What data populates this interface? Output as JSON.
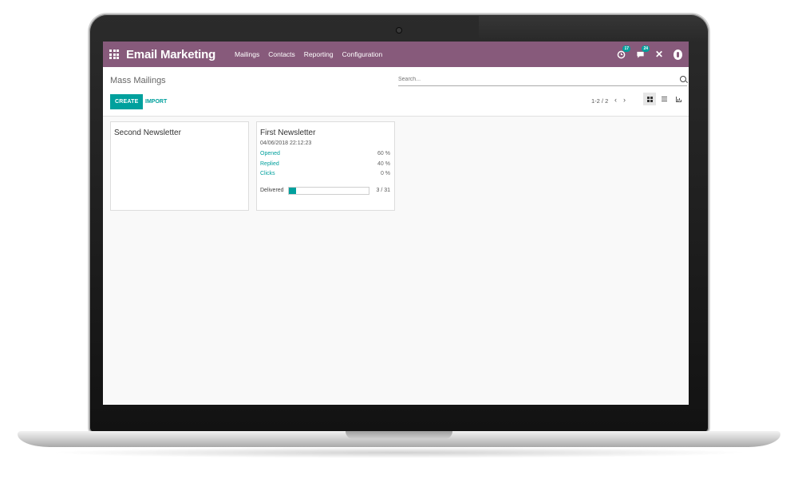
{
  "app": {
    "title": "Email Marketing",
    "menu": [
      "Mailings",
      "Contacts",
      "Reporting",
      "Configuration"
    ],
    "badges": {
      "activities": "17",
      "messages": "24"
    }
  },
  "control_panel": {
    "breadcrumb": "Mass Mailings",
    "search_placeholder": "Search...",
    "create_label": "CREATE",
    "import_label": "IMPORT",
    "pager": "1-2 / 2",
    "views": [
      "kanban",
      "list",
      "graph"
    ],
    "active_view": "kanban"
  },
  "cards": [
    {
      "title": "Second Newsletter"
    },
    {
      "title": "First Newsletter",
      "date": "04/06/2018 22:12:23",
      "stats": [
        {
          "label": "Opened",
          "value": "60 %"
        },
        {
          "label": "Replied",
          "value": "40 %"
        },
        {
          "label": "Clicks",
          "value": "0 %"
        }
      ],
      "delivered_label": "Delivered",
      "delivered_count": "3 / 31",
      "delivered_fraction": 0.0968
    }
  ],
  "colors": {
    "topbar": "#875a7b",
    "accent": "#00a09d"
  },
  "icons": [
    "apps-grid-icon",
    "activity-clock-icon",
    "messages-icon",
    "close-icon",
    "user-avatar-icon",
    "search-icon",
    "chevron-left-icon",
    "chevron-right-icon",
    "kanban-view-icon",
    "list-view-icon",
    "graph-view-icon"
  ]
}
